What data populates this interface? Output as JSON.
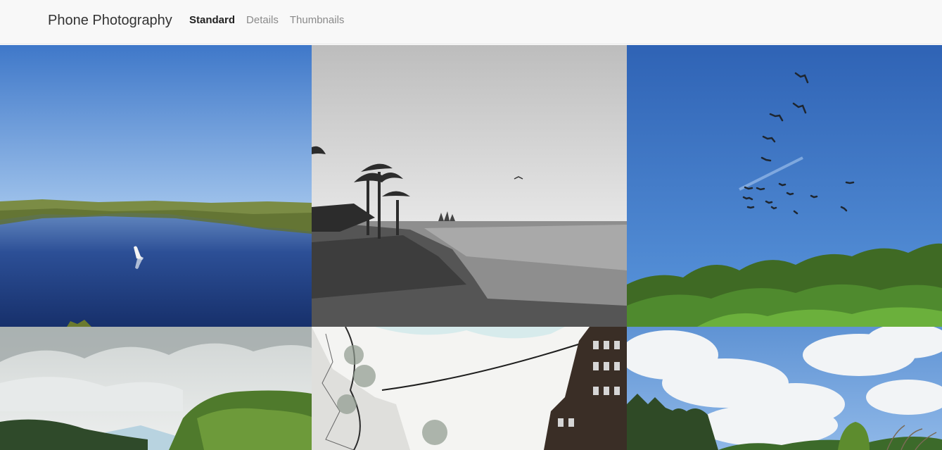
{
  "navbar": {
    "brand": "Phone Photography",
    "links": [
      {
        "label": "Standard",
        "active": true
      },
      {
        "label": "Details",
        "active": false
      },
      {
        "label": "Thumbnails",
        "active": false
      }
    ]
  },
  "gallery": {
    "photos": [
      {
        "subject": "egret-lake-photo"
      },
      {
        "subject": "palm-shore-bw-photo"
      },
      {
        "subject": "birds-sky-photo"
      },
      {
        "subject": "green-hills-photo"
      },
      {
        "subject": "street-sketch-photo"
      },
      {
        "subject": "trees-clouds-photo"
      }
    ]
  }
}
